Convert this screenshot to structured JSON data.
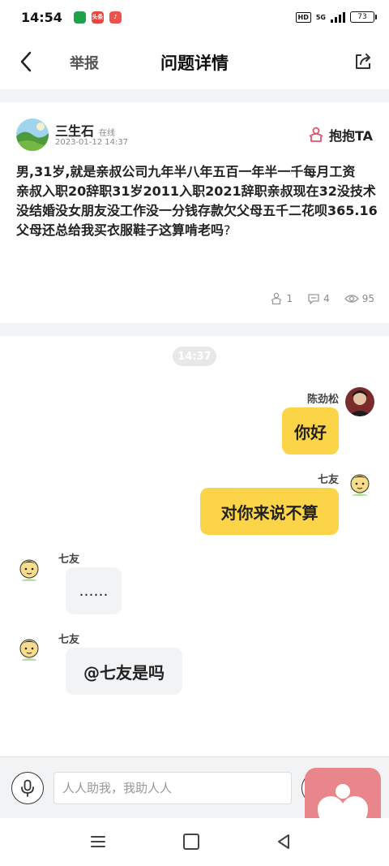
{
  "status_bar": {
    "time": "14:54",
    "apps": [
      {
        "name": "app-1",
        "color": "#1fa14a",
        "label": ""
      },
      {
        "name": "app-2",
        "color": "#e8463f",
        "label": "头条"
      },
      {
        "name": "app-3",
        "color": "#f0524a",
        "label": "♪"
      }
    ],
    "hd": "HD",
    "network": "5G",
    "battery": "73"
  },
  "header": {
    "report": "举报",
    "title": "问题详情"
  },
  "question": {
    "user_name": "三生石",
    "online_status": "在线",
    "time": "2023-01-12  14:37",
    "hug_label": "抱抱TA",
    "body_line1": "男,31岁,就是亲叔公司九年半八年五百一年半一千每月工资",
    "body_line2": "亲叔入职20辞职31岁2011入职2021辞职亲叔现在32没技术没结婚没女朋友没工作没一分钱存款欠父母五千二花呗365.16父母还总给我买衣服鞋子这算啃老吗",
    "body_end": "?",
    "stats": {
      "hugs": "1",
      "comments": "4",
      "views": "95"
    }
  },
  "chat": {
    "time_divider": "14:37",
    "messages": [
      {
        "side": "right",
        "name": "陈劲松",
        "text": "你好"
      },
      {
        "side": "right",
        "name": "七友",
        "text": "对你来说不算"
      },
      {
        "side": "left",
        "name": "七友",
        "text": "……"
      },
      {
        "side": "left",
        "name": "七友",
        "text": "@七友是吗"
      }
    ]
  },
  "input": {
    "placeholder": "人人助我，我助人人"
  },
  "colors": {
    "bubble_right": "#fbd547",
    "bubble_left": "#f2f3f5",
    "hug_accent": "#e8506a",
    "floating_heart": "#e8868b"
  }
}
